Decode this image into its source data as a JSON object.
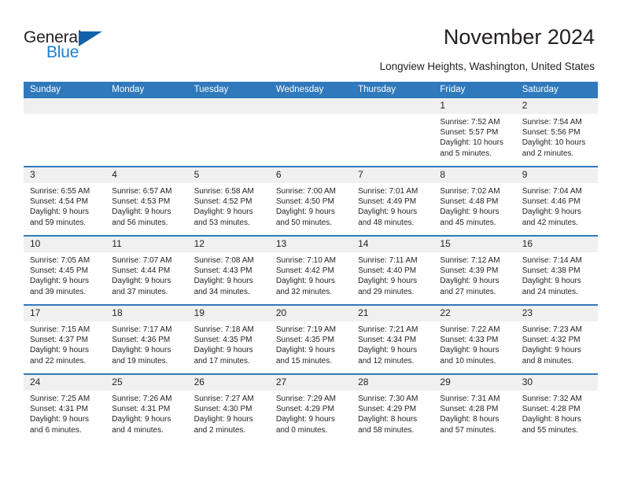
{
  "brand": {
    "name_part1": "General",
    "name_part2": "Blue",
    "accent_color": "#1a7fd4",
    "triangle_color": "#1162ab"
  },
  "header": {
    "title": "November 2024",
    "subtitle": "Longview Heights, Washington, United States"
  },
  "theme": {
    "header_row_bg": "#3079bc",
    "daynum_bg": "#f0f0f0",
    "text_color": "#231f20"
  },
  "weekday_headers": [
    "Sunday",
    "Monday",
    "Tuesday",
    "Wednesday",
    "Thursday",
    "Friday",
    "Saturday"
  ],
  "labels": {
    "sunrise": "Sunrise:",
    "sunset": "Sunset:",
    "daylight": "Daylight:"
  },
  "weeks": [
    [
      {
        "day": "",
        "sunrise": "",
        "sunset": "",
        "daylight_line1": "",
        "daylight_line2": ""
      },
      {
        "day": "",
        "sunrise": "",
        "sunset": "",
        "daylight_line1": "",
        "daylight_line2": ""
      },
      {
        "day": "",
        "sunrise": "",
        "sunset": "",
        "daylight_line1": "",
        "daylight_line2": ""
      },
      {
        "day": "",
        "sunrise": "",
        "sunset": "",
        "daylight_line1": "",
        "daylight_line2": ""
      },
      {
        "day": "",
        "sunrise": "",
        "sunset": "",
        "daylight_line1": "",
        "daylight_line2": ""
      },
      {
        "day": "1",
        "sunrise": "Sunrise: 7:52 AM",
        "sunset": "Sunset: 5:57 PM",
        "daylight_line1": "Daylight: 10 hours",
        "daylight_line2": "and 5 minutes."
      },
      {
        "day": "2",
        "sunrise": "Sunrise: 7:54 AM",
        "sunset": "Sunset: 5:56 PM",
        "daylight_line1": "Daylight: 10 hours",
        "daylight_line2": "and 2 minutes."
      }
    ],
    [
      {
        "day": "3",
        "sunrise": "Sunrise: 6:55 AM",
        "sunset": "Sunset: 4:54 PM",
        "daylight_line1": "Daylight: 9 hours",
        "daylight_line2": "and 59 minutes."
      },
      {
        "day": "4",
        "sunrise": "Sunrise: 6:57 AM",
        "sunset": "Sunset: 4:53 PM",
        "daylight_line1": "Daylight: 9 hours",
        "daylight_line2": "and 56 minutes."
      },
      {
        "day": "5",
        "sunrise": "Sunrise: 6:58 AM",
        "sunset": "Sunset: 4:52 PM",
        "daylight_line1": "Daylight: 9 hours",
        "daylight_line2": "and 53 minutes."
      },
      {
        "day": "6",
        "sunrise": "Sunrise: 7:00 AM",
        "sunset": "Sunset: 4:50 PM",
        "daylight_line1": "Daylight: 9 hours",
        "daylight_line2": "and 50 minutes."
      },
      {
        "day": "7",
        "sunrise": "Sunrise: 7:01 AM",
        "sunset": "Sunset: 4:49 PM",
        "daylight_line1": "Daylight: 9 hours",
        "daylight_line2": "and 48 minutes."
      },
      {
        "day": "8",
        "sunrise": "Sunrise: 7:02 AM",
        "sunset": "Sunset: 4:48 PM",
        "daylight_line1": "Daylight: 9 hours",
        "daylight_line2": "and 45 minutes."
      },
      {
        "day": "9",
        "sunrise": "Sunrise: 7:04 AM",
        "sunset": "Sunset: 4:46 PM",
        "daylight_line1": "Daylight: 9 hours",
        "daylight_line2": "and 42 minutes."
      }
    ],
    [
      {
        "day": "10",
        "sunrise": "Sunrise: 7:05 AM",
        "sunset": "Sunset: 4:45 PM",
        "daylight_line1": "Daylight: 9 hours",
        "daylight_line2": "and 39 minutes."
      },
      {
        "day": "11",
        "sunrise": "Sunrise: 7:07 AM",
        "sunset": "Sunset: 4:44 PM",
        "daylight_line1": "Daylight: 9 hours",
        "daylight_line2": "and 37 minutes."
      },
      {
        "day": "12",
        "sunrise": "Sunrise: 7:08 AM",
        "sunset": "Sunset: 4:43 PM",
        "daylight_line1": "Daylight: 9 hours",
        "daylight_line2": "and 34 minutes."
      },
      {
        "day": "13",
        "sunrise": "Sunrise: 7:10 AM",
        "sunset": "Sunset: 4:42 PM",
        "daylight_line1": "Daylight: 9 hours",
        "daylight_line2": "and 32 minutes."
      },
      {
        "day": "14",
        "sunrise": "Sunrise: 7:11 AM",
        "sunset": "Sunset: 4:40 PM",
        "daylight_line1": "Daylight: 9 hours",
        "daylight_line2": "and 29 minutes."
      },
      {
        "day": "15",
        "sunrise": "Sunrise: 7:12 AM",
        "sunset": "Sunset: 4:39 PM",
        "daylight_line1": "Daylight: 9 hours",
        "daylight_line2": "and 27 minutes."
      },
      {
        "day": "16",
        "sunrise": "Sunrise: 7:14 AM",
        "sunset": "Sunset: 4:38 PM",
        "daylight_line1": "Daylight: 9 hours",
        "daylight_line2": "and 24 minutes."
      }
    ],
    [
      {
        "day": "17",
        "sunrise": "Sunrise: 7:15 AM",
        "sunset": "Sunset: 4:37 PM",
        "daylight_line1": "Daylight: 9 hours",
        "daylight_line2": "and 22 minutes."
      },
      {
        "day": "18",
        "sunrise": "Sunrise: 7:17 AM",
        "sunset": "Sunset: 4:36 PM",
        "daylight_line1": "Daylight: 9 hours",
        "daylight_line2": "and 19 minutes."
      },
      {
        "day": "19",
        "sunrise": "Sunrise: 7:18 AM",
        "sunset": "Sunset: 4:35 PM",
        "daylight_line1": "Daylight: 9 hours",
        "daylight_line2": "and 17 minutes."
      },
      {
        "day": "20",
        "sunrise": "Sunrise: 7:19 AM",
        "sunset": "Sunset: 4:35 PM",
        "daylight_line1": "Daylight: 9 hours",
        "daylight_line2": "and 15 minutes."
      },
      {
        "day": "21",
        "sunrise": "Sunrise: 7:21 AM",
        "sunset": "Sunset: 4:34 PM",
        "daylight_line1": "Daylight: 9 hours",
        "daylight_line2": "and 12 minutes."
      },
      {
        "day": "22",
        "sunrise": "Sunrise: 7:22 AM",
        "sunset": "Sunset: 4:33 PM",
        "daylight_line1": "Daylight: 9 hours",
        "daylight_line2": "and 10 minutes."
      },
      {
        "day": "23",
        "sunrise": "Sunrise: 7:23 AM",
        "sunset": "Sunset: 4:32 PM",
        "daylight_line1": "Daylight: 9 hours",
        "daylight_line2": "and 8 minutes."
      }
    ],
    [
      {
        "day": "24",
        "sunrise": "Sunrise: 7:25 AM",
        "sunset": "Sunset: 4:31 PM",
        "daylight_line1": "Daylight: 9 hours",
        "daylight_line2": "and 6 minutes."
      },
      {
        "day": "25",
        "sunrise": "Sunrise: 7:26 AM",
        "sunset": "Sunset: 4:31 PM",
        "daylight_line1": "Daylight: 9 hours",
        "daylight_line2": "and 4 minutes."
      },
      {
        "day": "26",
        "sunrise": "Sunrise: 7:27 AM",
        "sunset": "Sunset: 4:30 PM",
        "daylight_line1": "Daylight: 9 hours",
        "daylight_line2": "and 2 minutes."
      },
      {
        "day": "27",
        "sunrise": "Sunrise: 7:29 AM",
        "sunset": "Sunset: 4:29 PM",
        "daylight_line1": "Daylight: 9 hours",
        "daylight_line2": "and 0 minutes."
      },
      {
        "day": "28",
        "sunrise": "Sunrise: 7:30 AM",
        "sunset": "Sunset: 4:29 PM",
        "daylight_line1": "Daylight: 8 hours",
        "daylight_line2": "and 58 minutes."
      },
      {
        "day": "29",
        "sunrise": "Sunrise: 7:31 AM",
        "sunset": "Sunset: 4:28 PM",
        "daylight_line1": "Daylight: 8 hours",
        "daylight_line2": "and 57 minutes."
      },
      {
        "day": "30",
        "sunrise": "Sunrise: 7:32 AM",
        "sunset": "Sunset: 4:28 PM",
        "daylight_line1": "Daylight: 8 hours",
        "daylight_line2": "and 55 minutes."
      }
    ]
  ]
}
